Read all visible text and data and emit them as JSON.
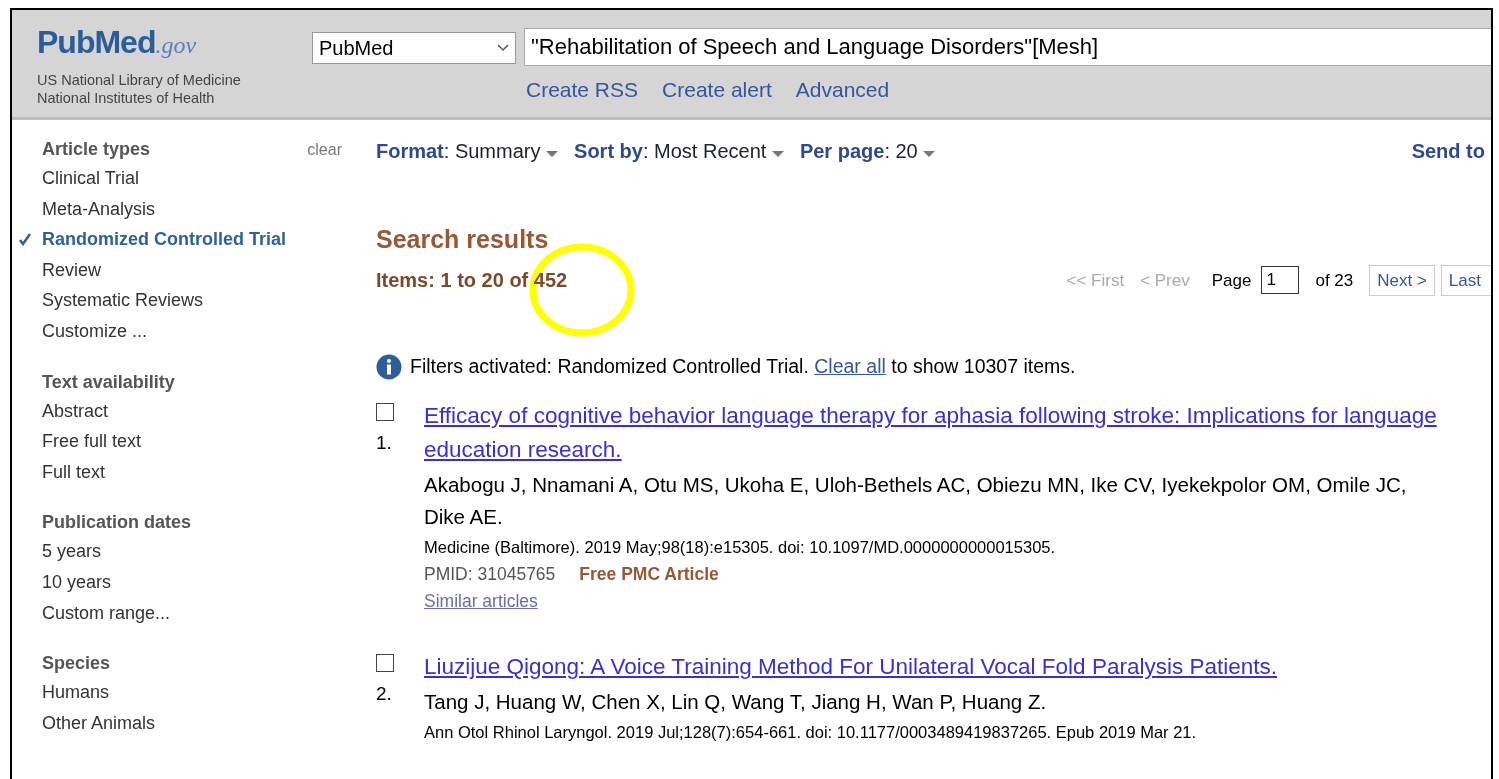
{
  "header": {
    "logo": {
      "brand": "PubMed",
      "suffix": ".gov"
    },
    "org_lines": [
      "US National Library of Medicine",
      "National Institutes of Health"
    ],
    "database_select": {
      "value": "PubMed"
    },
    "search": {
      "value": "\"Rehabilitation of Speech and Language Disorders\"[Mesh]"
    },
    "links": [
      "Create RSS",
      "Create alert",
      "Advanced"
    ]
  },
  "sidebar": [
    {
      "title": "Article types",
      "action": "clear",
      "items": [
        {
          "label": "Clinical Trial",
          "selected": false
        },
        {
          "label": "Meta-Analysis",
          "selected": false
        },
        {
          "label": "Randomized Controlled Trial",
          "selected": true
        },
        {
          "label": "Review",
          "selected": false
        },
        {
          "label": "Systematic Reviews",
          "selected": false
        },
        {
          "label": "Customize ...",
          "selected": false
        }
      ]
    },
    {
      "title": "Text availability",
      "items": [
        {
          "label": "Abstract",
          "selected": false
        },
        {
          "label": "Free full text",
          "selected": false
        },
        {
          "label": "Full text",
          "selected": false
        }
      ]
    },
    {
      "title": "Publication dates",
      "items": [
        {
          "label": "5 years",
          "selected": false
        },
        {
          "label": "10 years",
          "selected": false
        },
        {
          "label": "Custom range...",
          "selected": false
        }
      ]
    },
    {
      "title": "Species",
      "items": [
        {
          "label": "Humans",
          "selected": false
        },
        {
          "label": "Other Animals",
          "selected": false
        }
      ]
    }
  ],
  "display_bar": [
    {
      "label": "Format",
      "value": ": Summary"
    },
    {
      "label": "Sort by",
      "value": ": Most Recent"
    },
    {
      "label": "Per page",
      "value": ": 20"
    }
  ],
  "send_to": "Send to",
  "results_title": "Search results",
  "items_count": "Items: 1 to 20 of 452",
  "pagination": {
    "first": {
      "label": "<< First",
      "disabled": true
    },
    "prev": {
      "label": "< Prev",
      "disabled": true
    },
    "page_label": "Page",
    "page_value": "1",
    "of_label": "of 23",
    "next": {
      "label": "Next >",
      "disabled": false
    },
    "last": {
      "label": "Last",
      "disabled": false
    }
  },
  "filter_note": {
    "before": "Filters activated: Randomized Controlled Trial.",
    "link": "Clear all",
    "after": "to show 10307 items."
  },
  "results": [
    {
      "number": "1.",
      "checked": false,
      "title": "Efficacy of cognitive behavior language therapy for aphasia following stroke: Implications for language education research.",
      "authors": "Akabogu J, Nnamani A, Otu MS, Ukoha E, Uloh-Bethels AC, Obiezu MN, Ike CV, Iyekekpolor OM, Omile JC, Dike AE.",
      "citation": "Medicine (Baltimore). 2019 May;98(18):e15305. doi: 10.1097/MD.0000000000015305.",
      "pmid": "PMID: 31045765",
      "free_pmc": "Free PMC Article",
      "similar": "Similar articles"
    },
    {
      "number": "2.",
      "checked": false,
      "title": "Liuzijue Qigong: A Voice Training Method For Unilateral Vocal Fold Paralysis Patients.",
      "authors": "Tang J, Huang W, Chen X, Lin Q, Wang T, Jiang H, Wan P, Huang Z.",
      "citation": "Ann Otol Rhinol Laryngol. 2019 Jul;128(7):654-661. doi: 10.1177/0003489419837265. Epub 2019 Mar 21."
    }
  ]
}
